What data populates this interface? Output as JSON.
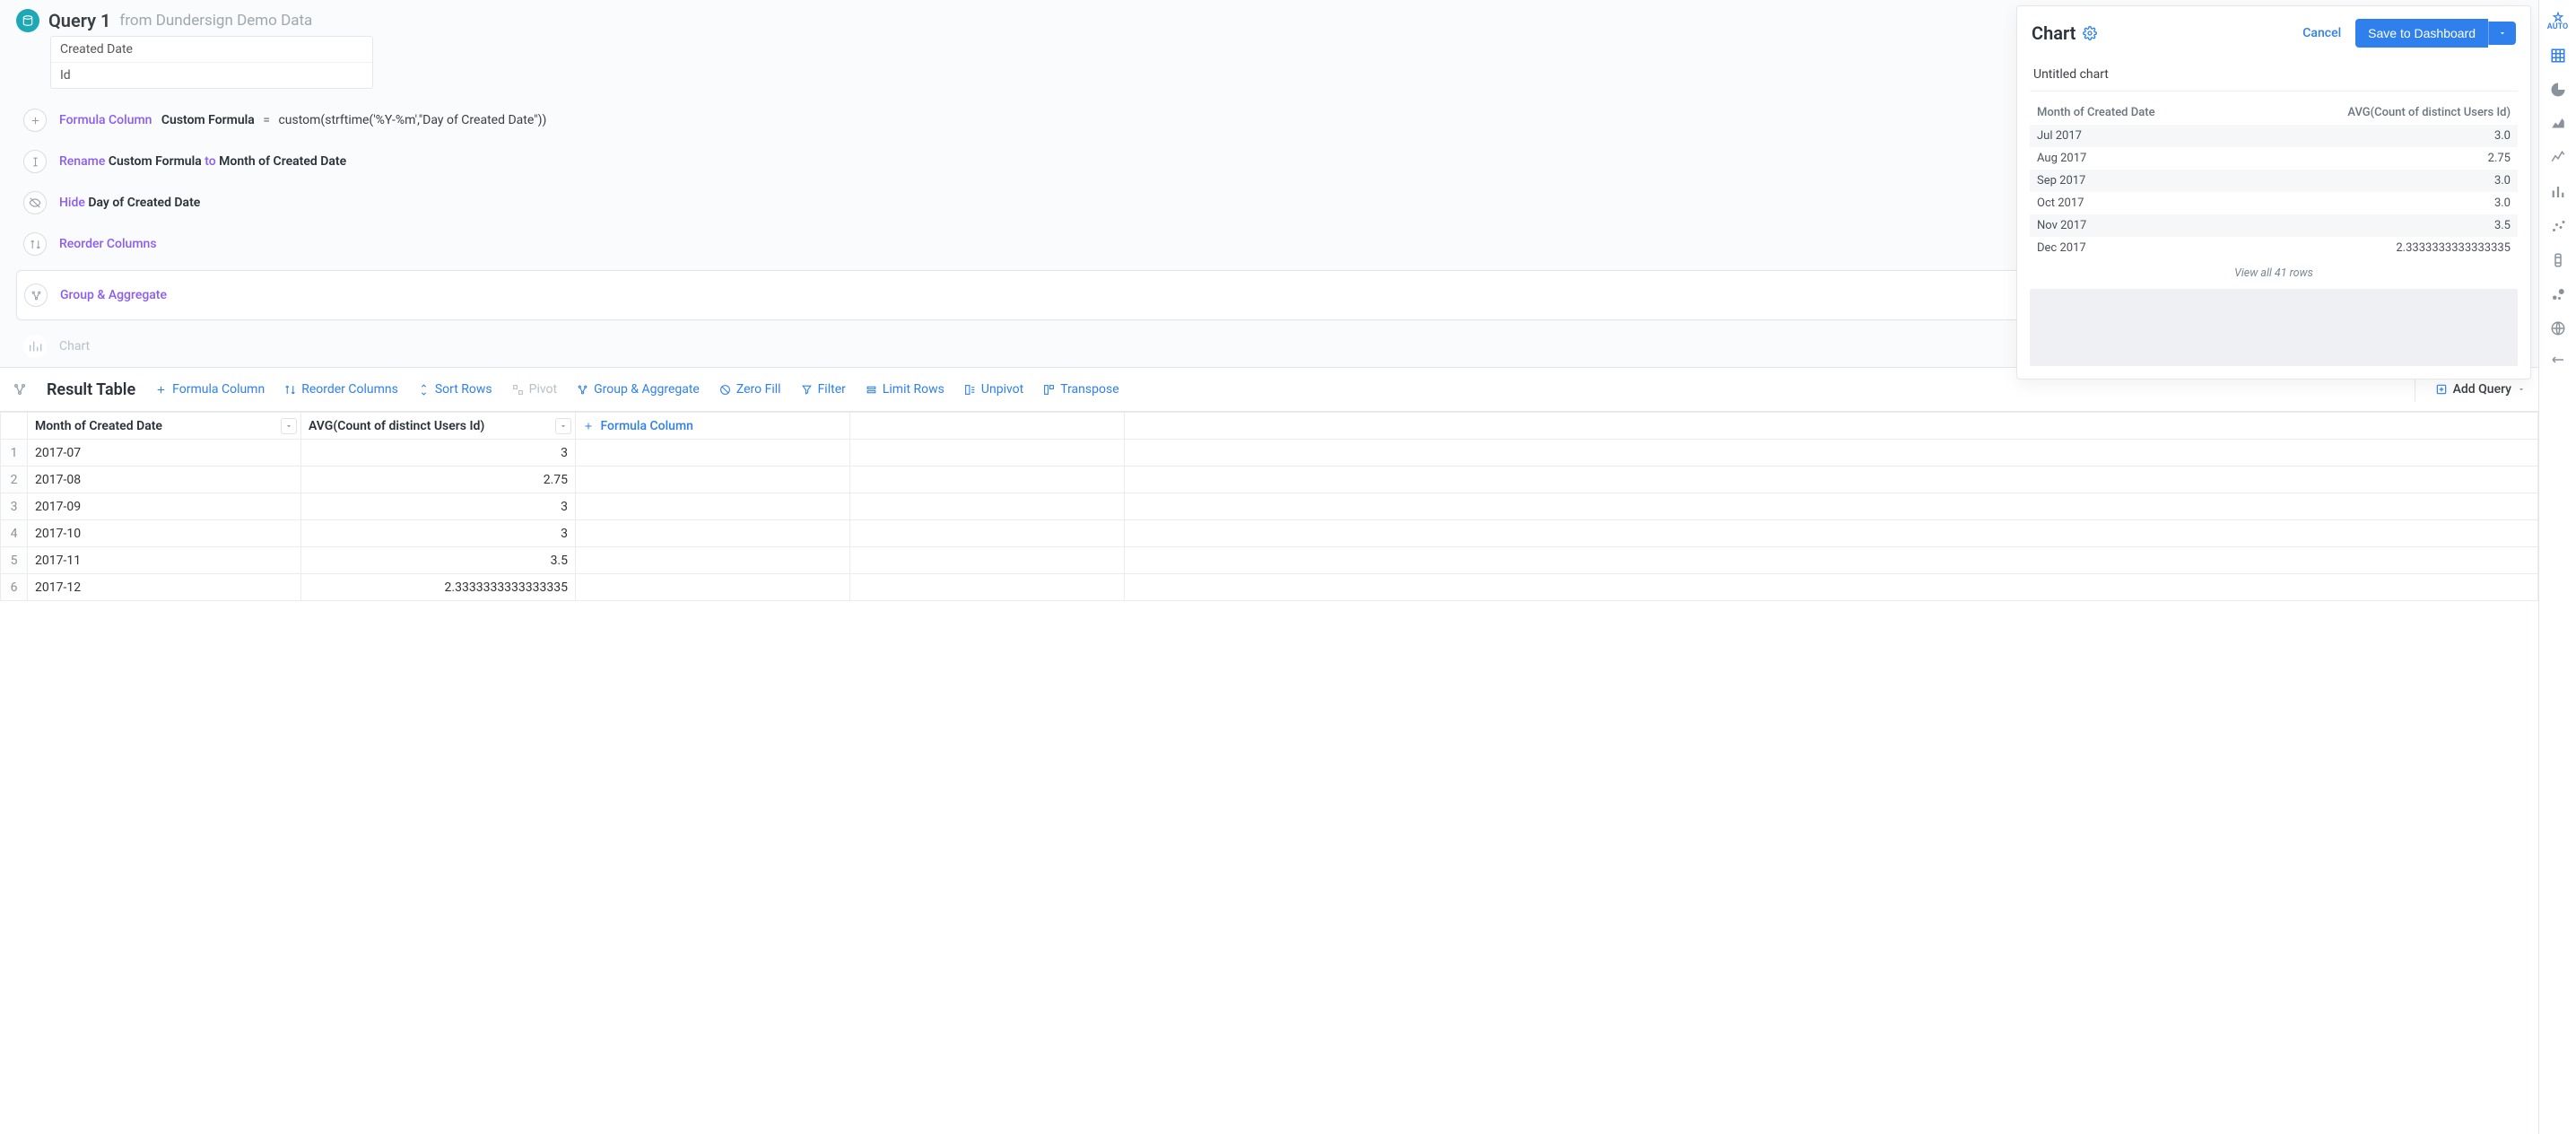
{
  "query": {
    "title": "Query 1",
    "source_prefix": "from",
    "source": "Dundersign Demo Data",
    "columns": [
      "Created Date",
      "Id"
    ]
  },
  "steps": {
    "formula": {
      "label": "Formula Column",
      "name": "Custom Formula",
      "expr": "custom(strftime('%Y-%m',\"Day of Created Date\"))"
    },
    "rename": {
      "label": "Rename",
      "from": "Custom Formula",
      "to_kw": "to",
      "to": "Month of Created Date"
    },
    "hide": {
      "label": "Hide",
      "target": "Day of Created Date"
    },
    "reorder": {
      "label": "Reorder Columns"
    },
    "group": {
      "label": "Group & Aggregate"
    },
    "chart": {
      "label": "Chart"
    }
  },
  "chart_panel": {
    "title": "Chart",
    "cancel": "Cancel",
    "save": "Save to Dashboard",
    "untitled": "Untitled chart",
    "col1": "Month of Created Date",
    "col2": "AVG(Count of distinct Users Id)",
    "rows": [
      {
        "m": "Jul 2017",
        "v": "3.0"
      },
      {
        "m": "Aug 2017",
        "v": "2.75"
      },
      {
        "m": "Sep 2017",
        "v": "3.0"
      },
      {
        "m": "Oct 2017",
        "v": "3.0"
      },
      {
        "m": "Nov 2017",
        "v": "3.5"
      },
      {
        "m": "Dec 2017",
        "v": "2.3333333333333335"
      }
    ],
    "view_all": "View all 41 rows"
  },
  "result_toolbar": {
    "title": "Result Table",
    "formula_column": "Formula Column",
    "reorder": "Reorder Columns",
    "sort": "Sort Rows",
    "pivot": "Pivot",
    "group": "Group & Aggregate",
    "zero_fill": "Zero Fill",
    "filter": "Filter",
    "limit": "Limit Rows",
    "unpivot": "Unpivot",
    "transpose": "Transpose",
    "add_query": "Add Query"
  },
  "table": {
    "headers": {
      "c1": "Month of Created Date",
      "c2": "AVG(Count of distinct Users Id)",
      "c3_formula": "Formula Column"
    },
    "rows": [
      {
        "n": "1",
        "m": "2017-07",
        "v": "3"
      },
      {
        "n": "2",
        "m": "2017-08",
        "v": "2.75"
      },
      {
        "n": "3",
        "m": "2017-09",
        "v": "3"
      },
      {
        "n": "4",
        "m": "2017-10",
        "v": "3"
      },
      {
        "n": "5",
        "m": "2017-11",
        "v": "3.5"
      },
      {
        "n": "6",
        "m": "2017-12",
        "v": "2.3333333333333335"
      }
    ]
  },
  "rail": {
    "auto": "AUTO"
  },
  "chart_data": {
    "type": "table",
    "title": "Untitled chart",
    "columns": [
      "Month of Created Date",
      "AVG(Count of distinct Users Id)"
    ],
    "rows": [
      [
        "Jul 2017",
        3.0
      ],
      [
        "Aug 2017",
        2.75
      ],
      [
        "Sep 2017",
        3.0
      ],
      [
        "Oct 2017",
        3.0
      ],
      [
        "Nov 2017",
        3.5
      ],
      [
        "Dec 2017",
        2.3333333333333335
      ]
    ],
    "total_rows": 41
  }
}
